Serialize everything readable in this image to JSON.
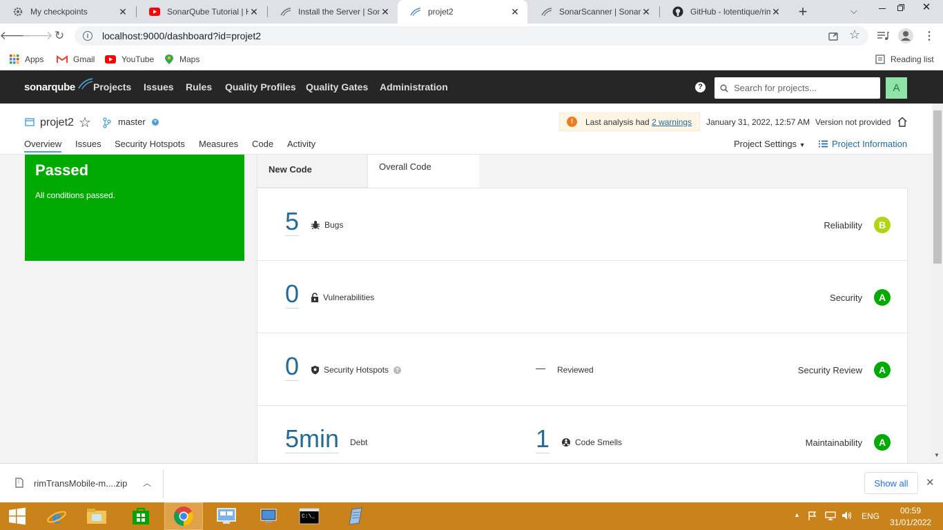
{
  "browser": {
    "tabs": [
      {
        "title": "My checkpoints",
        "icon": "gear-icon"
      },
      {
        "title": "SonarQube Tutorial | Ho",
        "icon": "youtube-icon"
      },
      {
        "title": "Install the Server | Sona",
        "icon": "sonar-icon"
      },
      {
        "title": "projet2",
        "icon": "sonar-icon",
        "active": true
      },
      {
        "title": "SonarScanner | SonarQ",
        "icon": "sonar-icon"
      },
      {
        "title": "GitHub - lotentique/rim",
        "icon": "github-icon"
      }
    ],
    "new_tab_label": "+",
    "url": "localhost:9000/dashboard?id=projet2",
    "bookmarks": [
      {
        "label": "Apps",
        "icon": "apps-grid-icon"
      },
      {
        "label": "Gmail",
        "icon": "gmail-icon"
      },
      {
        "label": "YouTube",
        "icon": "youtube-icon"
      },
      {
        "label": "Maps",
        "icon": "maps-icon"
      }
    ],
    "reading_list": "Reading list"
  },
  "sonar_nav": {
    "logo": "sonarqube",
    "links": [
      "Projects",
      "Issues",
      "Rules",
      "Quality Profiles",
      "Quality Gates",
      "Administration"
    ],
    "search_placeholder": "Search for projects...",
    "avatar_letter": "A"
  },
  "project": {
    "name": "projet2",
    "branch": "master",
    "warning_prefix": "Last analysis had",
    "warning_link": "2 warnings",
    "analysis_date": "January 31, 2022, 12:57 AM",
    "version": "Version not provided",
    "tabs": [
      "Overview",
      "Issues",
      "Security Hotspots",
      "Measures",
      "Code",
      "Activity"
    ],
    "settings": "Project Settings",
    "info": "Project Information"
  },
  "quality_gate": {
    "status": "Passed",
    "message": "All conditions passed."
  },
  "leak_tabs": {
    "new_code": "New Code",
    "overall": "Overall Code"
  },
  "measures": {
    "bugs": {
      "value": "5",
      "label": "Bugs",
      "category": "Reliability",
      "rating": "B"
    },
    "vulnerabilities": {
      "value": "0",
      "label": "Vulnerabilities",
      "category": "Security",
      "rating": "A"
    },
    "hotspots": {
      "value": "0",
      "label": "Security Hotspots",
      "reviewed_value": "—",
      "reviewed_label": "Reviewed",
      "category": "Security Review",
      "rating": "A"
    },
    "debt": {
      "value": "5min",
      "label": "Debt",
      "smells_value": "1",
      "smells_label": "Code Smells",
      "category": "Maintainability",
      "rating": "A"
    }
  },
  "colors": {
    "passed": "#00aa00",
    "rating_a": "#00aa00",
    "rating_b": "#b0d513",
    "measure_blue": "#236a97",
    "taskbar": "#c9831a"
  },
  "downloads": {
    "file": "rimTransMobile-m....zip",
    "show_all": "Show all"
  },
  "taskbar": {
    "time": "00:59",
    "date": "31/01/2022",
    "lang": "ENG"
  }
}
